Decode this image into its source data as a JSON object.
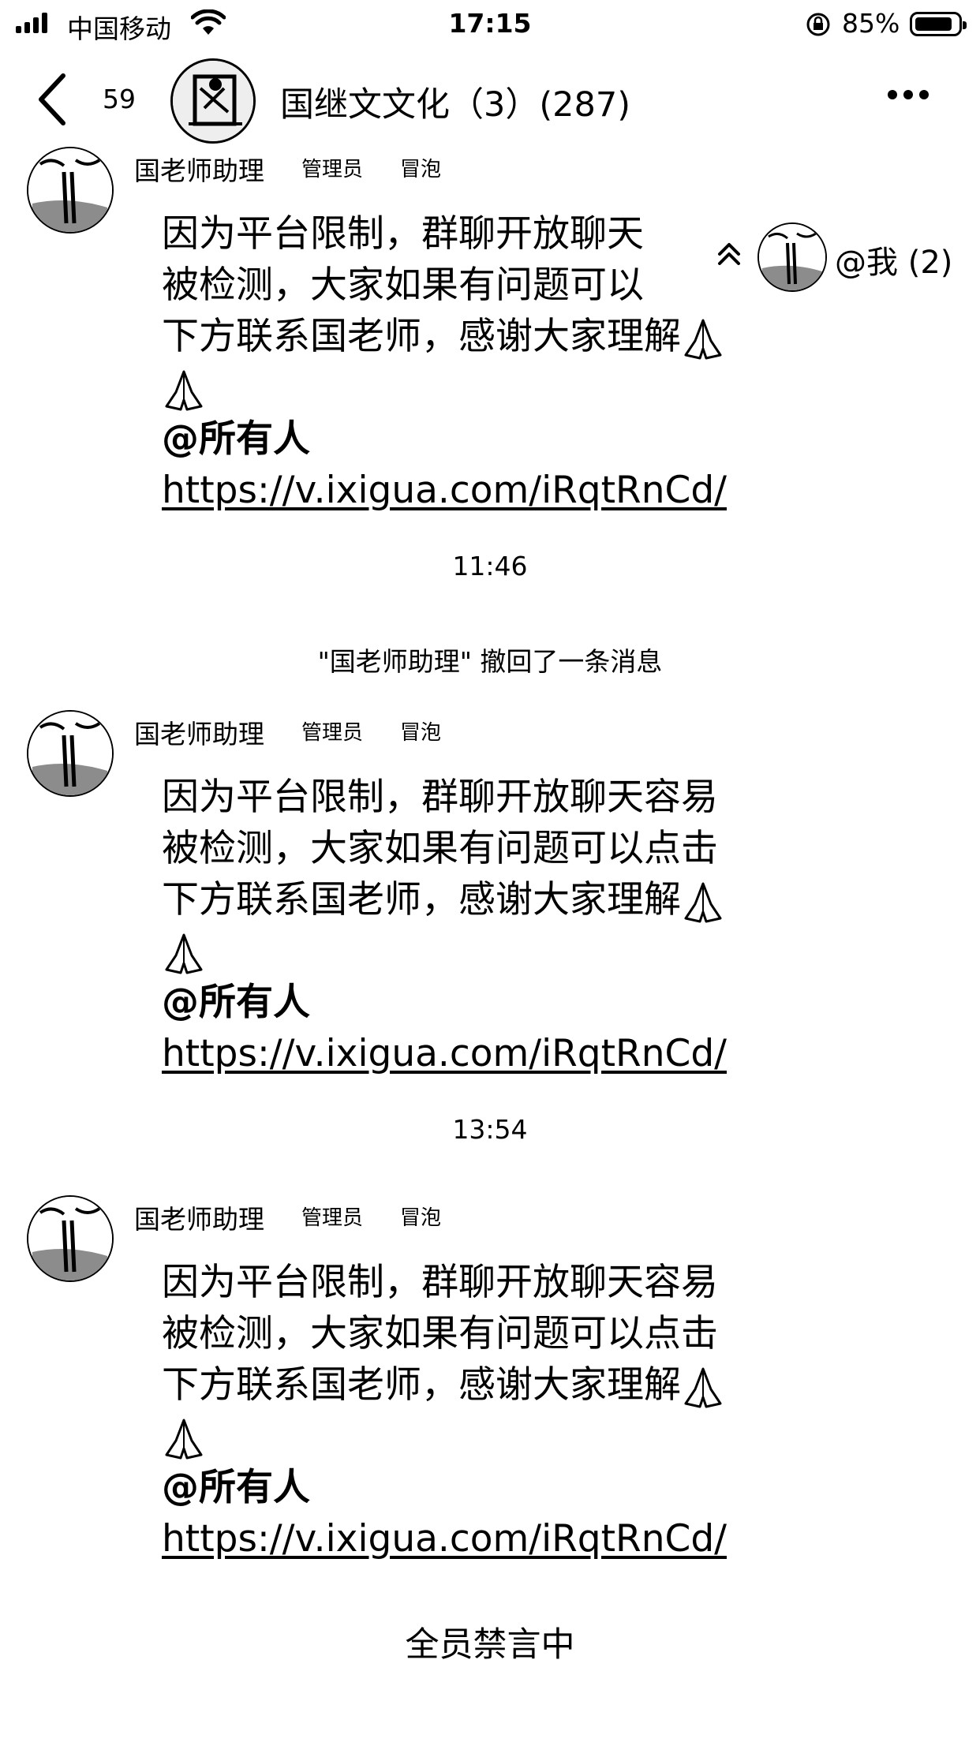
{
  "status_bar": {
    "carrier": "中国移动",
    "time": "17:15",
    "battery": "85%"
  },
  "nav": {
    "back_count": "59",
    "title": "国继文文化（3）(287)"
  },
  "mention_chip": {
    "label": "@我 (2)"
  },
  "messages": [
    {
      "sender": "国老师助理",
      "role": "管理员",
      "tag": "冒泡",
      "lines": [
        "因为平台限制，群聊开放聊天",
        "被检测，大家如果有问题可以",
        "下方联系国老师，感谢大家理解"
      ],
      "mention": "@所有人",
      "link": "https://v.ixigua.com/iRqtRnCd/"
    },
    {
      "sender": "国老师助理",
      "role": "管理员",
      "tag": "冒泡",
      "lines": [
        "因为平台限制，群聊开放聊天容易",
        "被检测，大家如果有问题可以点击",
        "下方联系国老师，感谢大家理解"
      ],
      "mention": "@所有人",
      "link": "https://v.ixigua.com/iRqtRnCd/"
    },
    {
      "sender": "国老师助理",
      "role": "管理员",
      "tag": "冒泡",
      "lines": [
        "因为平台限制，群聊开放聊天容易",
        "被检测，大家如果有问题可以点击",
        "下方联系国老师，感谢大家理解"
      ],
      "mention": "@所有人",
      "link": "https://v.ixigua.com/iRqtRnCd/"
    }
  ],
  "timestamps": [
    "11:46",
    "13:54"
  ],
  "system_notice": "\"国老师助理\" 撤回了一条消息",
  "footer_notice": "全员禁言中"
}
